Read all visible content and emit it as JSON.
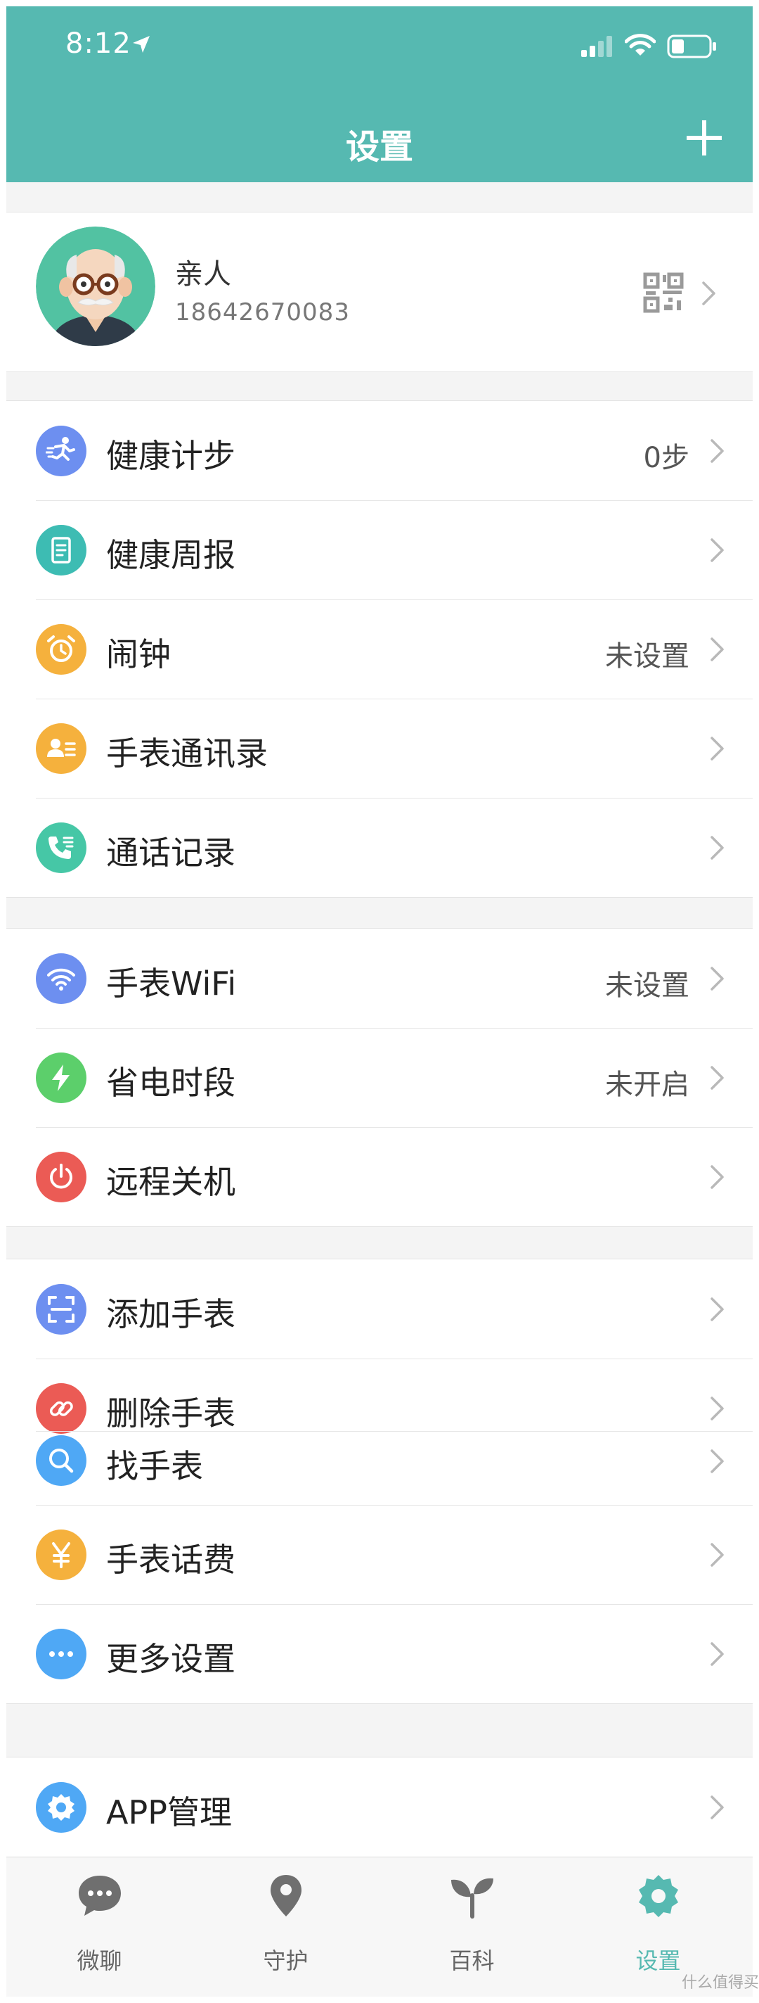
{
  "status_bar": {
    "time": "8:12"
  },
  "header": {
    "title": "设置"
  },
  "profile": {
    "name": "亲人",
    "phone": "18642670083"
  },
  "sections": [
    [
      {
        "label": "健康计步",
        "value": "0步",
        "icon": "runner-icon",
        "color": "#6d8ff0"
      },
      {
        "label": "健康周报",
        "value": "",
        "icon": "report-icon",
        "color": "#3dbcb3"
      },
      {
        "label": "闹钟",
        "value": "未设置",
        "icon": "alarm-clock-icon",
        "color": "#f5b13d"
      },
      {
        "label": "手表通讯录",
        "value": "",
        "icon": "contacts-icon",
        "color": "#f5b13d"
      },
      {
        "label": "通话记录",
        "value": "",
        "icon": "phone-icon",
        "color": "#46c7a6"
      }
    ],
    [
      {
        "label": "手表WiFi",
        "value": "未设置",
        "icon": "wifi-icon",
        "color": "#6d8ff0"
      },
      {
        "label": "省电时段",
        "value": "未开启",
        "icon": "lightning-icon",
        "color": "#5ccf6b"
      },
      {
        "label": "远程关机",
        "value": "",
        "icon": "power-icon",
        "color": "#eb5b55"
      }
    ],
    [
      {
        "label": "添加手表",
        "value": "",
        "icon": "scan-icon",
        "color": "#6d8ff0"
      },
      {
        "label": "删除手表",
        "value": "",
        "icon": "unlink-icon",
        "color": "#eb5b55"
      },
      {
        "label": "找手表",
        "value": "",
        "icon": "search-icon",
        "color": "#4fa8f5"
      },
      {
        "label": "手表话费",
        "value": "",
        "icon": "yen-icon",
        "color": "#f5b13d"
      },
      {
        "label": "更多设置",
        "value": "",
        "icon": "more-icon",
        "color": "#4fa8f5"
      }
    ],
    [
      {
        "label": "APP管理",
        "value": "",
        "icon": "gear-icon",
        "color": "#4fa8f5"
      }
    ]
  ],
  "tabs": [
    {
      "label": "微聊",
      "icon": "chat-icon"
    },
    {
      "label": "守护",
      "icon": "location-pin-icon"
    },
    {
      "label": "百科",
      "icon": "sprout-icon"
    },
    {
      "label": "设置",
      "icon": "gear-icon",
      "active": true
    }
  ],
  "colors": {
    "primary": "#56b9b1",
    "background": "#f4f4f4"
  },
  "watermark": "什么值得买"
}
